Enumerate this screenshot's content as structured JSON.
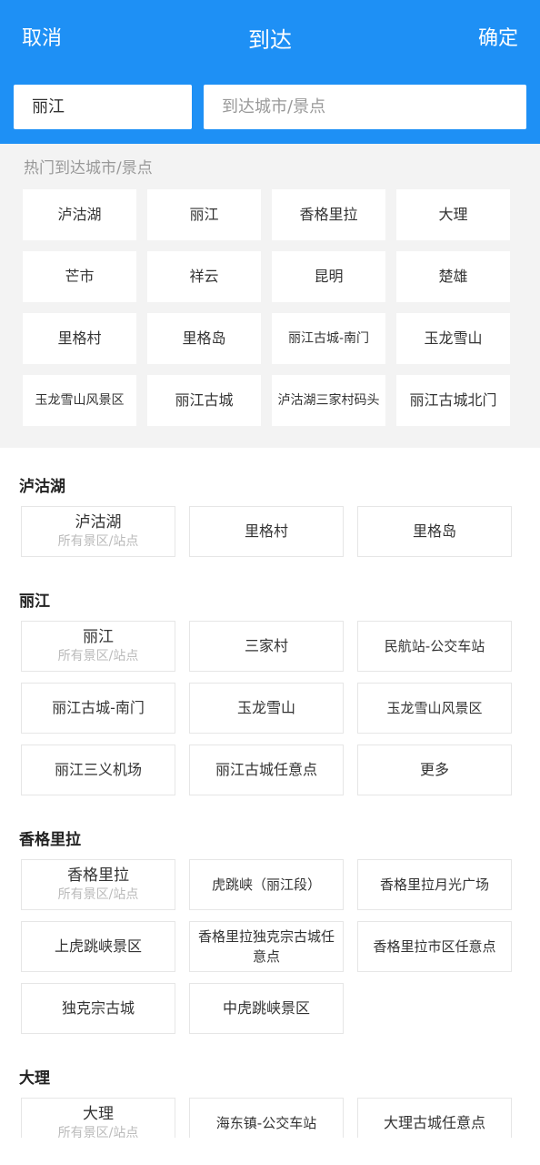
{
  "header": {
    "cancel_label": "取消",
    "title": "到达",
    "confirm_label": "确定",
    "from_value": "丽江",
    "to_placeholder": "到达城市/景点",
    "color": "#1e90f5"
  },
  "hot": {
    "title": "热门到达城市/景点",
    "items": [
      "泸沽湖",
      "丽江",
      "香格里拉",
      "大理",
      "芒市",
      "祥云",
      "昆明",
      "楚雄",
      "里格村",
      "里格岛",
      "丽江古城-南门",
      "玉龙雪山",
      "玉龙雪山风景区",
      "丽江古城",
      "泸沽湖三家村码头",
      "丽江古城北门"
    ]
  },
  "sections": [
    {
      "title": "泸沽湖",
      "first": {
        "name": "泸沽湖",
        "sub": "所有景区/站点"
      },
      "items": [
        "里格村",
        "里格岛"
      ]
    },
    {
      "title": "丽江",
      "first": {
        "name": "丽江",
        "sub": "所有景区/站点"
      },
      "items": [
        "三家村",
        "民航站-公交车站",
        "丽江古城-南门",
        "玉龙雪山",
        "玉龙雪山风景区",
        "丽江三义机场",
        "丽江古城任意点",
        "更多"
      ]
    },
    {
      "title": "香格里拉",
      "first": {
        "name": "香格里拉",
        "sub": "所有景区/站点"
      },
      "items": [
        "虎跳峡（丽江段）",
        "香格里拉月光广场",
        "上虎跳峡景区",
        "香格里拉独克宗古城任意点",
        "香格里拉市区任意点",
        "独克宗古城",
        "中虎跳峡景区"
      ]
    },
    {
      "title": "大理",
      "first": {
        "name": "大理",
        "sub": "所有景区/站点"
      },
      "items": [
        "海东镇-公交车站",
        "大理古城任意点"
      ]
    }
  ]
}
